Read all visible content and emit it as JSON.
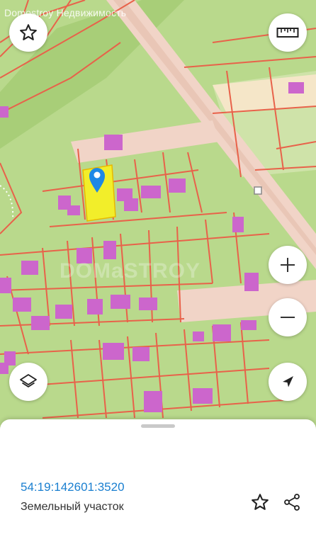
{
  "watermark": {
    "top_text": "Domostroy Недвижимость",
    "center_text": "DOMaSTROY"
  },
  "colors": {
    "map_background": "#b9d98c",
    "parcel_border": "#e8624a",
    "road": "#f1d4c7",
    "building": "#cc66cc",
    "selected_parcel": "#f2ee2a",
    "marker": "#1e88e5",
    "link_text": "#1a7fd0"
  },
  "map_controls": {
    "favorite_icon": "star-icon",
    "ruler_icon": "ruler-icon",
    "zoom_in_icon": "plus-icon",
    "zoom_out_icon": "minus-icon",
    "layers_icon": "layers-icon",
    "location_icon": "navigation-arrow-icon"
  },
  "parcel": {
    "cadastral_number": "54:19:142601:3520",
    "type": "Земельный участок"
  },
  "sheet_actions": {
    "favorite_icon": "star-outline-icon",
    "share_icon": "share-icon"
  }
}
